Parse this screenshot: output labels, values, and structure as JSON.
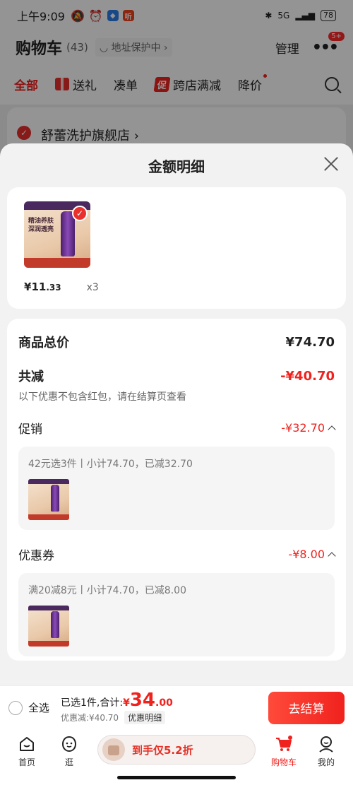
{
  "status_bar": {
    "time": "上午9:09",
    "network": "5G",
    "battery": "78"
  },
  "header": {
    "title": "购物车",
    "count": "(43)",
    "address_protect": "◡ 地址保护中 ›",
    "manage": "管理",
    "more_badge": "5+"
  },
  "tabs": [
    {
      "label": "全部",
      "active": true
    },
    {
      "label": "送礼"
    },
    {
      "label": "凑单"
    },
    {
      "label": "跨店满减",
      "tag": "促"
    },
    {
      "label": "降价"
    }
  ],
  "store": {
    "name": "舒蕾洗护旗舰店 ›"
  },
  "sheet": {
    "title": "金额明细",
    "product": {
      "image_text": "精油养肤\n深润透亮",
      "price_symbol": "¥",
      "price_int": "11",
      "price_dec": ".33",
      "qty": "x3"
    },
    "summary": {
      "total_label": "商品总价",
      "total_value": "¥74.70",
      "discount_label": "共减",
      "discount_value": "-¥40.70",
      "discount_note": "以下优惠不包含红包，请在结算页查看",
      "promo_label": "促销",
      "promo_value": "-¥32.70",
      "promo_detail": "42元选3件丨小计74.70，已减32.70",
      "coupon_label": "优惠券",
      "coupon_value": "-¥8.00",
      "coupon_detail": "满20减8元丨小计74.70，已减8.00"
    }
  },
  "checkout": {
    "select_all": "全选",
    "selected_text": "已选1件,合计:",
    "currency": "¥",
    "total_int": "34",
    "total_dec": ".00",
    "discount_text": "优惠减:¥40.70",
    "detail_chip": "优惠明细",
    "button": "去结算"
  },
  "bottom_nav": {
    "home": "首页",
    "browse": "逛",
    "promo_pill": "到手仅5.2折",
    "cart": "购物车",
    "mine": "我的"
  },
  "colors": {
    "accent": "#f0221e",
    "checkout_button": "#f0221e"
  }
}
